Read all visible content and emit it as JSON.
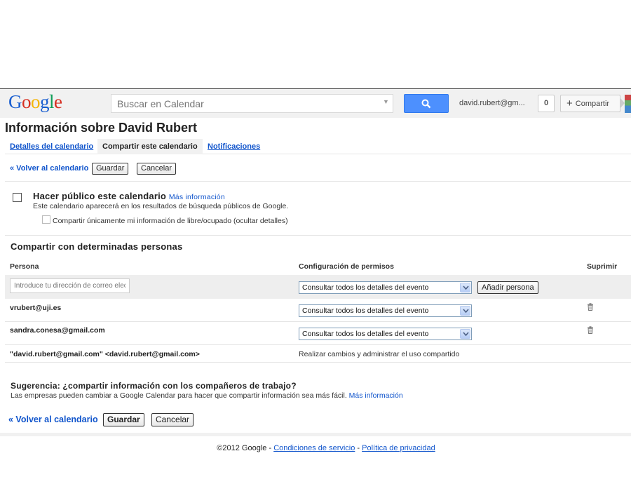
{
  "header": {
    "logo": "Google",
    "search_placeholder": "Buscar en Calendar",
    "account": "david.rubert@gm...",
    "notification_count": "0",
    "share_label": "Compartir"
  },
  "page": {
    "title": "Información sobre David Rubert",
    "tabs": [
      {
        "label": "Detalles del calendario"
      },
      {
        "label": "Compartir este calendario"
      },
      {
        "label": "Notificaciones"
      }
    ],
    "back_label": "« Volver al calendario",
    "save_label": "Guardar",
    "cancel_label": "Cancelar"
  },
  "public": {
    "title": "Hacer público este calendario",
    "more_info": "Más información",
    "description": "Este calendario aparecerá en los resultados de búsqueda públicos de Google.",
    "free_busy_label": "Compartir únicamente mi información de libre/ocupado (ocultar detalles)"
  },
  "sharing": {
    "title": "Compartir con determinadas personas",
    "columns": {
      "person": "Persona",
      "permissions": "Configuración de permisos",
      "remove": "Suprimir"
    },
    "email_placeholder": "Introduce tu dirección de correo electrónico",
    "add_button": "Añadir persona",
    "default_permission": "Consultar todos los detalles del evento",
    "rows": [
      {
        "person": "vrubert@uji.es",
        "permission": "Consultar todos los detalles del evento"
      },
      {
        "person": "sandra.conesa@gmail.com",
        "permission": "Consultar todos los detalles del evento"
      },
      {
        "person": "\"david.rubert@gmail.com\" <david.rubert@gmail.com>",
        "permission": "Realizar cambios y administrar el uso compartido"
      }
    ]
  },
  "tip": {
    "title": "Sugerencia: ¿compartir información con los compañeros de trabajo?",
    "text": "Las empresas pueden cambiar a Google Calendar para hacer que compartir información sea más fácil.",
    "link": "Más información"
  },
  "footer": {
    "copyright": "©2012 Google - ",
    "terms": "Condiciones de servicio",
    "dash": " - ",
    "privacy": "Política de privacidad"
  },
  "colors": {
    "link": "#1155cc",
    "search_button": "#4d90fe",
    "header_bg": "#f1f1f1"
  }
}
